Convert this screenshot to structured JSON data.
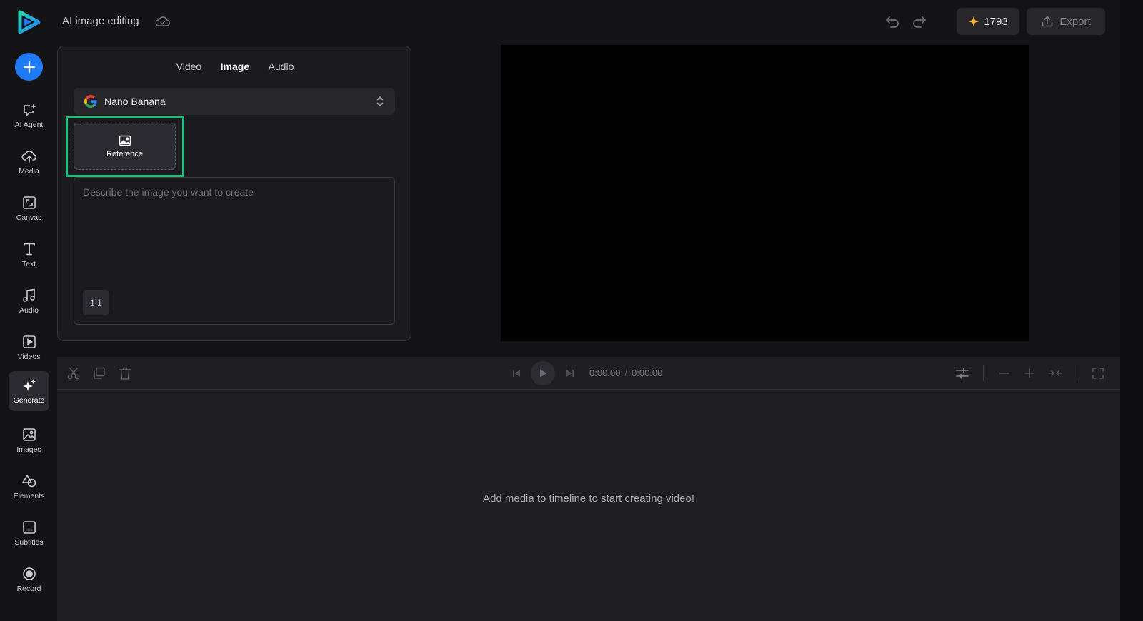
{
  "header": {
    "project_title": "AI image editing",
    "credits": "1793",
    "export_label": "Export"
  },
  "sidebar": {
    "items": [
      {
        "label": "AI Agent",
        "icon": "ai-agent-icon"
      },
      {
        "label": "Media",
        "icon": "cloud-upload-icon"
      },
      {
        "label": "Canvas",
        "icon": "canvas-icon"
      },
      {
        "label": "Text",
        "icon": "text-icon"
      },
      {
        "label": "Audio",
        "icon": "music-note-icon"
      },
      {
        "label": "Videos",
        "icon": "video-play-icon"
      },
      {
        "label": "Generate",
        "icon": "sparkle-icon",
        "active": true
      },
      {
        "label": "Images",
        "icon": "image-icon"
      },
      {
        "label": "Elements",
        "icon": "shapes-icon"
      },
      {
        "label": "Subtitles",
        "icon": "subtitles-icon"
      },
      {
        "label": "Record",
        "icon": "record-icon"
      }
    ]
  },
  "generate_panel": {
    "tabs": [
      "Video",
      "Image",
      "Audio"
    ],
    "active_tab": "Image",
    "model": "Nano Banana",
    "reference_label": "Reference",
    "prompt_placeholder": "Describe the image you want to create",
    "prompt_value": "",
    "aspect_ratio": "1:1"
  },
  "timeline": {
    "current_time": "0:00.00",
    "total_time": "0:00.00",
    "separator": "/",
    "empty_message": "Add media to timeline to start creating video!"
  },
  "colors": {
    "accent_blue": "#1f7bf5",
    "highlight_green": "#19c37d",
    "credit_star": "#f5b82e",
    "background": "#141417"
  }
}
